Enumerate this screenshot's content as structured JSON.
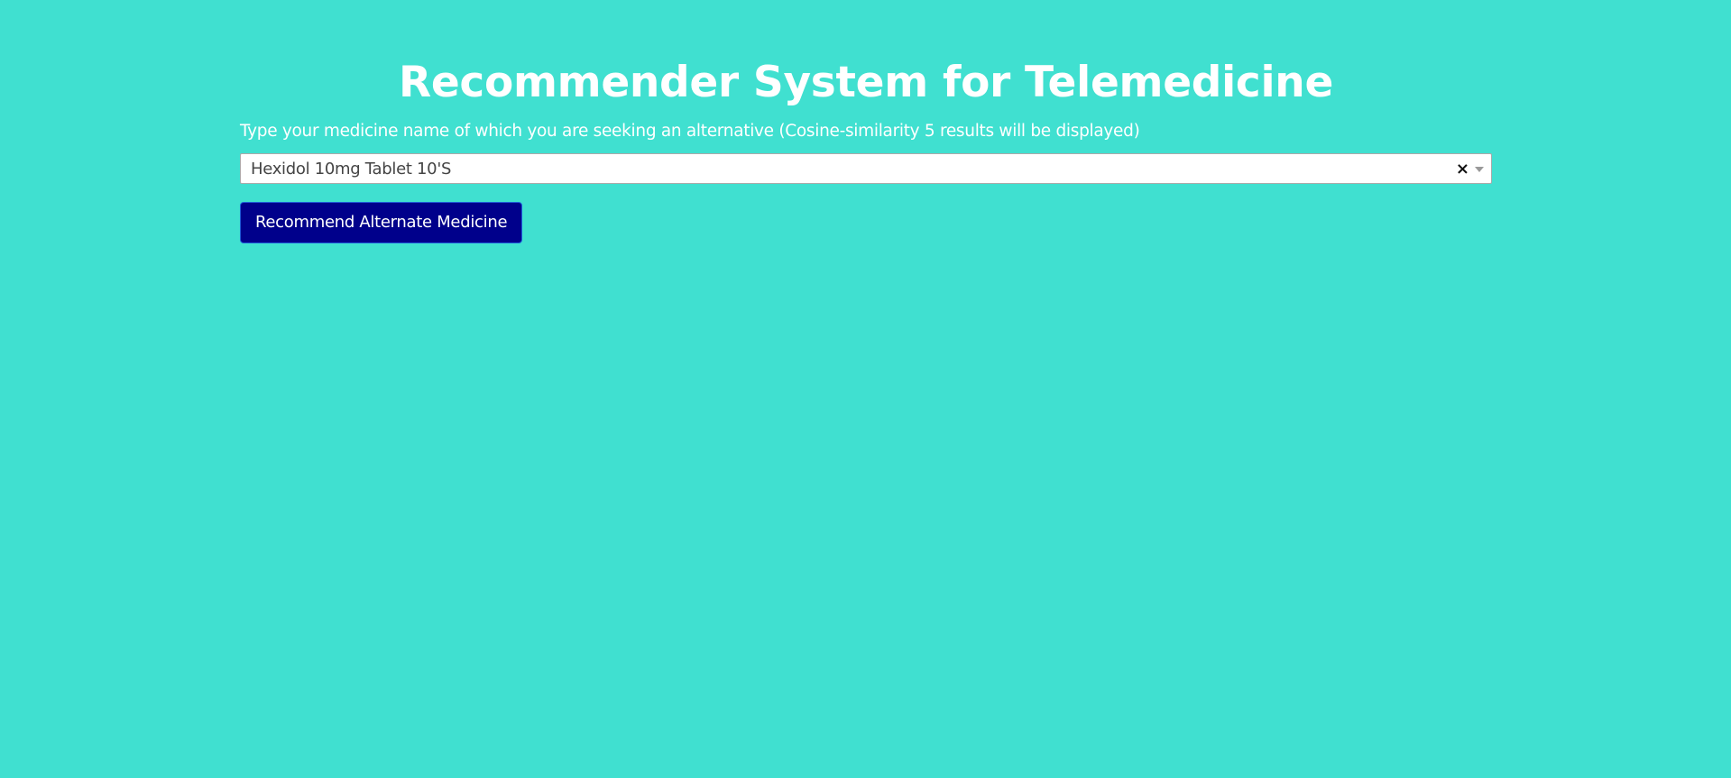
{
  "header": {
    "title": "Recommender System for Telemedicine"
  },
  "form": {
    "instruction": "Type your medicine name of which you are seeking an alternative (Cosine-similarity 5 results will be displayed)",
    "select": {
      "value": "Hexidol 10mg Tablet 10'S",
      "clear_glyph": "×"
    },
    "button_label": "Recommend Alternate Medicine"
  },
  "colors": {
    "background": "#40e0d0",
    "button": "#00008b",
    "text": "#ffffff"
  },
  "icons": [
    "close-icon",
    "chevron-down-icon"
  ]
}
